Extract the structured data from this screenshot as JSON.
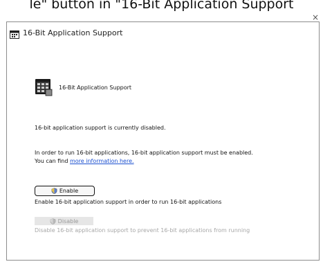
{
  "caption": "le\" button in \"16-Bit Application Support",
  "window": {
    "title": "16-Bit Application Support"
  },
  "hero": {
    "label": "16-Bit Application Support"
  },
  "status": "16-bit application support is currently disabled.",
  "info": {
    "line1": "In order to run 16-bit applications, 16-bit application support must be enabled.",
    "line2_prefix": "You can find ",
    "line2_link": "more information here."
  },
  "enable": {
    "label": "Enable",
    "description": "Enable 16-bit application support in order to run 16-bit applications"
  },
  "disable": {
    "label": "Disable",
    "description": "Disable 16-bit application support to prevent 16-bit applications from running"
  },
  "icons": {
    "title_icon": "app-window-icon",
    "hero_icon": "application-grid-icon",
    "shield_icon": "uac-shield-icon",
    "close_icon": "close-icon"
  }
}
